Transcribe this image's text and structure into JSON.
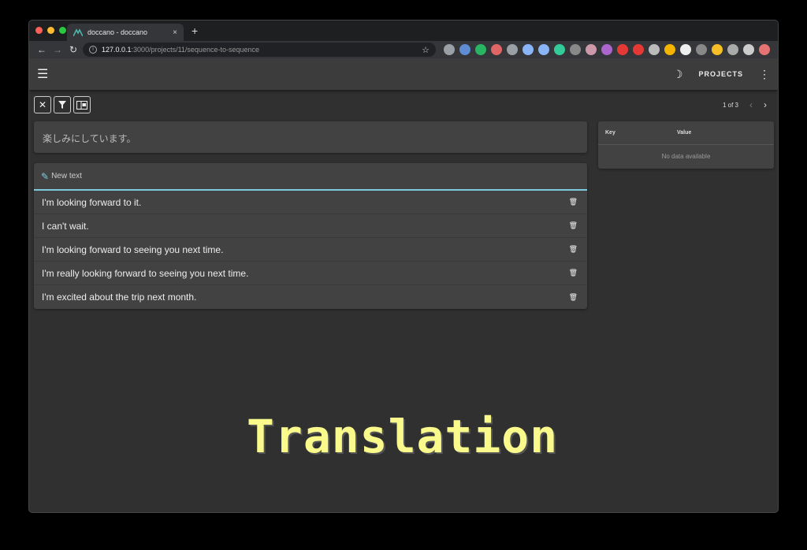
{
  "browser": {
    "tab_title": "doccano - doccano",
    "tab_close": "×",
    "new_tab": "+",
    "url_host": "127.0.0.1",
    "url_path": ":3000/projects/11/sequence-to-sequence",
    "traffic_light_colors": [
      "#fe5f57",
      "#febc2e",
      "#28c840"
    ],
    "extension_colors": [
      "#9aa0a6",
      "#5f8dd3",
      "#28b463",
      "#e06666",
      "#9aa0a6",
      "#8ab4f8",
      "#8ab4f8",
      "#3c9",
      "#888",
      "#c9a",
      "#aa66cc",
      "#e53935",
      "#e53935",
      "#bbb",
      "#f4b400",
      "#eee",
      "#888",
      "#f6bf26",
      "#aaa",
      "#ccc",
      "#e57373"
    ]
  },
  "appbar": {
    "menu_icon": "menu-icon",
    "projects_label": "PROJECTS"
  },
  "toolbar": {
    "buttons": [
      "close-icon",
      "filter-icon",
      "metadata-panel-icon"
    ]
  },
  "pager": {
    "label": "1 of 3"
  },
  "source": {
    "text": "楽しみにしています。"
  },
  "annotations": {
    "new_text_placeholder": "New text",
    "items": [
      "I'm looking forward to it.",
      "I can't wait.",
      "I'm looking forward to seeing you next time.",
      "I'm really looking forward to seeing you next time.",
      "I'm excited about the trip next month."
    ]
  },
  "metadata": {
    "key_header": "Key",
    "value_header": "Value",
    "empty_text": "No data available"
  },
  "overlay": {
    "title": "Translation",
    "color": "#fafa8c"
  }
}
